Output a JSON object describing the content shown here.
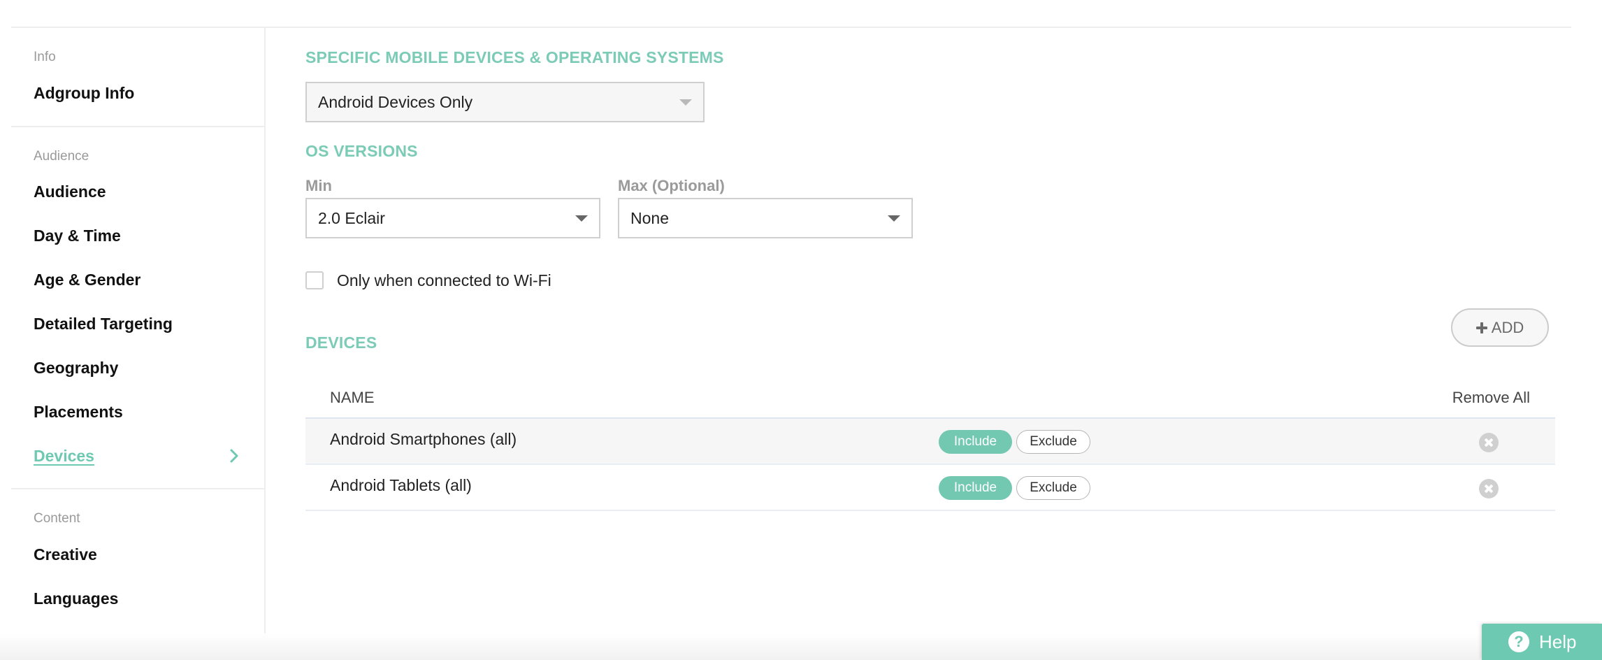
{
  "sidebar": {
    "info": {
      "caption": "Info",
      "items": [
        {
          "label": "Adgroup Info"
        }
      ]
    },
    "audience": {
      "caption": "Audience",
      "items": [
        {
          "label": "Audience"
        },
        {
          "label": "Day & Time"
        },
        {
          "label": "Age & Gender"
        },
        {
          "label": "Detailed Targeting"
        },
        {
          "label": "Geography"
        },
        {
          "label": "Placements"
        },
        {
          "label": "Devices",
          "active": true
        }
      ]
    },
    "content": {
      "caption": "Content",
      "items": [
        {
          "label": "Creative"
        },
        {
          "label": "Languages"
        }
      ]
    }
  },
  "main": {
    "specific_devices": {
      "title": "SPECIFIC MOBILE DEVICES & OPERATING SYSTEMS",
      "selected": "Android Devices Only"
    },
    "os_versions": {
      "title": "OS VERSIONS",
      "min": {
        "label": "Min",
        "selected": "2.0 Eclair"
      },
      "max": {
        "label": "Max (Optional)",
        "selected": "None"
      }
    },
    "wifi": {
      "label": "Only when connected to Wi-Fi",
      "checked": false
    },
    "devices": {
      "title": "DEVICES",
      "add_label": "ADD",
      "columns": {
        "name": "NAME",
        "remove_all": "Remove All"
      },
      "rows": [
        {
          "name": "Android Smartphones (all)",
          "include": "Include",
          "exclude": "Exclude",
          "state": "include"
        },
        {
          "name": "Android Tablets (all)",
          "include": "Include",
          "exclude": "Exclude",
          "state": "include"
        }
      ]
    }
  },
  "help": {
    "label": "Help"
  },
  "colors": {
    "accent": "#6ec9b2",
    "section_title": "#7ccbb6",
    "divider": "#eeeeee"
  },
  "icons": {
    "sidebar_active": "chevron-right-icon",
    "add": "plus-icon",
    "remove": "remove-circle-icon",
    "help": "question-circle-icon",
    "select": "caret-down-icon"
  }
}
